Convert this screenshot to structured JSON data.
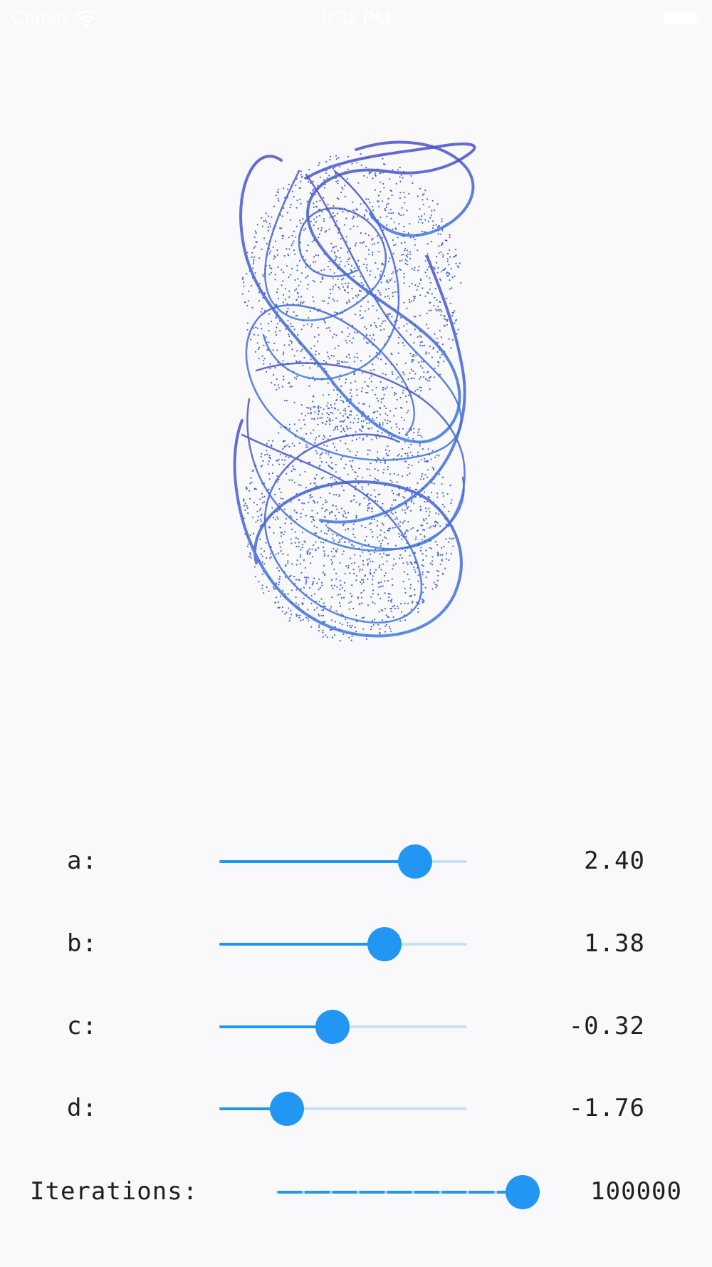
{
  "status_bar": {
    "carrier": "Carrier",
    "time": "8:32 PM"
  },
  "attractor": {
    "color_top": "#4a50c8",
    "color_bottom": "#3f78dd"
  },
  "parameters": [
    {
      "label": "a:",
      "value": "2.40",
      "fraction": 0.79
    },
    {
      "label": "b:",
      "value": "1.38",
      "fraction": 0.667
    },
    {
      "label": "c:",
      "value": "-0.32",
      "fraction": 0.457
    },
    {
      "label": "d:",
      "value": "-1.76",
      "fraction": 0.273
    }
  ],
  "iterations": {
    "label": "Iterations:",
    "value": "100000",
    "fraction": 1.0,
    "divisions": 9
  },
  "colors": {
    "accent": "#2196f3",
    "track_inactive": "#c7e1f6",
    "background": "#f9f9fb"
  }
}
